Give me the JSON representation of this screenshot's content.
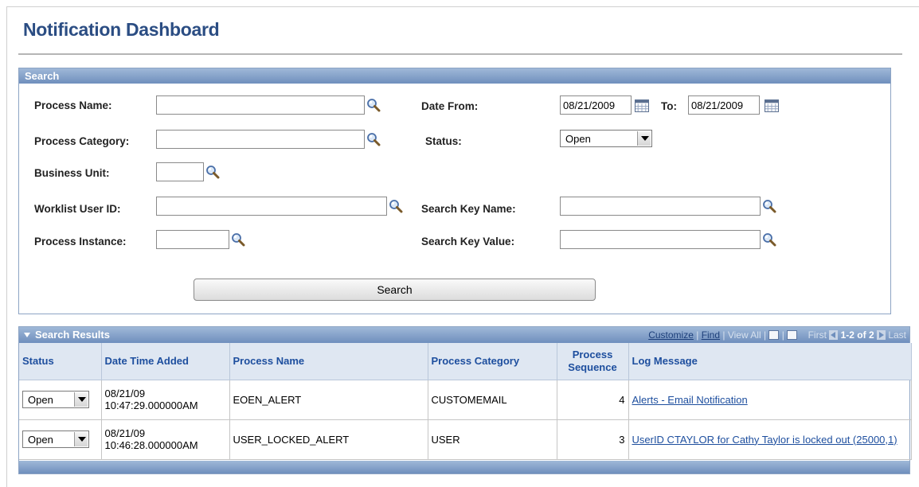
{
  "page": {
    "title": "Notification Dashboard"
  },
  "search": {
    "header": "Search",
    "labels": {
      "process_name": "Process Name:",
      "process_category": "Process Category:",
      "business_unit": "Business Unit:",
      "worklist_user_id": "Worklist User ID:",
      "process_instance": "Process Instance:",
      "date_from": "Date From:",
      "to": "To:",
      "status": "Status:",
      "search_key_name": "Search Key Name:",
      "search_key_value": "Search Key Value:"
    },
    "values": {
      "process_name": "",
      "process_category": "",
      "business_unit": "",
      "worklist_user_id": "",
      "process_instance": "",
      "date_from": "08/21/2009",
      "date_to": "08/21/2009",
      "status": "Open",
      "search_key_name": "",
      "search_key_value": ""
    },
    "button_label": "Search"
  },
  "results": {
    "header": "Search Results",
    "tools": {
      "customize": "Customize",
      "find": "Find",
      "view_all": "View All",
      "first": "First",
      "range": "1-2 of 2",
      "last": "Last"
    },
    "columns": [
      "Status",
      "Date Time Added",
      "Process Name",
      "Process Category",
      "Process Sequence",
      "Log Message"
    ],
    "rows": [
      {
        "status": "Open",
        "date_line1": "08/21/09",
        "date_line2": "10:47:29.000000AM",
        "process_name": "EOEN_ALERT",
        "process_category": "CUSTOMEMAIL",
        "process_sequence": "4",
        "log_message": "Alerts - Email Notification"
      },
      {
        "status": "Open",
        "date_line1": "08/21/09",
        "date_line2": "10:46:28.000000AM",
        "process_name": "USER_LOCKED_ALERT",
        "process_category": "USER",
        "process_sequence": "3",
        "log_message": "UserID CTAYLOR for Cathy Taylor is locked out (25000,1)"
      }
    ]
  },
  "icons": {
    "lookup": "magnifier-icon",
    "calendar": "calendar-icon"
  },
  "colors": {
    "title": "#2b4d83",
    "header_bar": "#7f9ec8",
    "link": "#1d4e9e"
  }
}
